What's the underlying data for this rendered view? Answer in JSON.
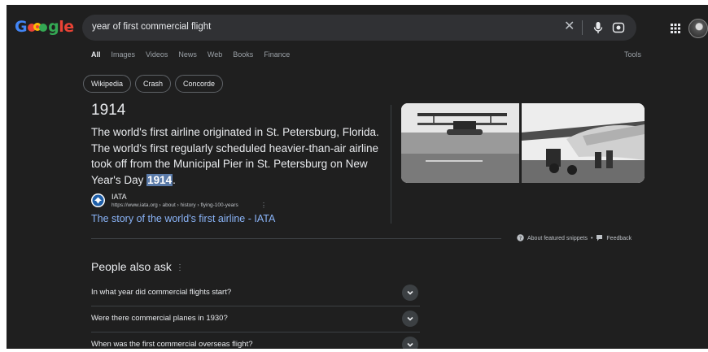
{
  "logo": {
    "text": "Google"
  },
  "search": {
    "query": "year of first commercial flight"
  },
  "tabs": [
    {
      "label": "All"
    },
    {
      "label": "Images"
    },
    {
      "label": "Videos"
    },
    {
      "label": "News"
    },
    {
      "label": "Web"
    },
    {
      "label": "Books"
    },
    {
      "label": "Finance"
    }
  ],
  "tools_label": "Tools",
  "chips": [
    {
      "label": "Wikipedia"
    },
    {
      "label": "Crash"
    },
    {
      "label": "Concorde"
    }
  ],
  "snippet": {
    "answer": "1914",
    "description_before": "The world's first airline originated in St. Petersburg, Florida. The world's first regularly scheduled heavier-than-air airline took off from the Municipal Pier in St. Petersburg on New Year's Day ",
    "description_highlight": "1914",
    "description_after": ".",
    "source_name": "IATA",
    "source_url": "https://www.iata.org › about › history › flying-100-years",
    "source_link": "The story of the world's first airline - IATA",
    "about_label": "About featured snippets",
    "separator": "•",
    "feedback_label": "Feedback"
  },
  "people_also_ask": {
    "title": "People also ask",
    "questions": [
      "In what year did commercial flights start?",
      "Were there commercial planes in 1930?",
      "When was the first commercial overseas flight?"
    ]
  }
}
